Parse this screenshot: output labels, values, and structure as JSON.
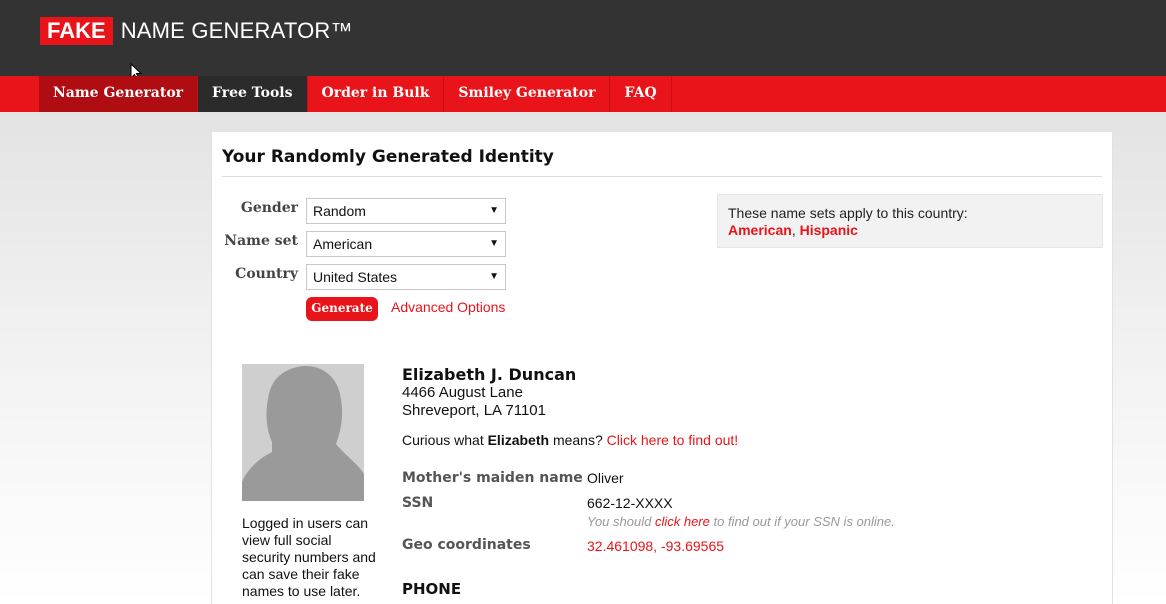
{
  "header": {
    "logo_fake": "FAKE",
    "logo_rest": "NAME GENERATOR™"
  },
  "nav": {
    "items": [
      {
        "label": "Name Generator"
      },
      {
        "label": "Free Tools"
      },
      {
        "label": "Order in Bulk"
      },
      {
        "label": "Smiley Generator"
      },
      {
        "label": "FAQ"
      }
    ]
  },
  "main": {
    "title": "Your Randomly Generated Identity",
    "form": {
      "gender_label": "Gender",
      "gender_value": "Random",
      "nameset_label": "Name set",
      "nameset_value": "American",
      "country_label": "Country",
      "country_value": "United States",
      "generate_label": "Generate",
      "advanced_label": "Advanced Options"
    },
    "country_info": {
      "text": "These name sets apply to this country:",
      "set1": "American",
      "separator": ", ",
      "set2": "Hispanic"
    },
    "avatar_note": "Logged in users can view full social security numbers and can save their fake names to use later.",
    "identity": {
      "name": "Elizabeth J. Duncan",
      "address_line1": "4466 August Lane",
      "address_line2": "Shreveport, LA 71101",
      "curious_prefix": "Curious what ",
      "curious_name": "Elizabeth",
      "curious_mid": " means? ",
      "curious_link": "Click here to find out!"
    },
    "details": {
      "maiden_label": "Mother's maiden name",
      "maiden_value": "Oliver",
      "ssn_label": "SSN",
      "ssn_value": "662-12-XXXX",
      "ssn_note_prefix": "You should ",
      "ssn_note_link": "click here",
      "ssn_note_suffix": " to find out if your SSN is online.",
      "geo_label": "Geo coordinates",
      "geo_value": "32.461098, -93.69565",
      "phone_heading": "PHONE"
    }
  },
  "colors": {
    "brand_red": "#e8141a",
    "header_dark": "#333333"
  }
}
